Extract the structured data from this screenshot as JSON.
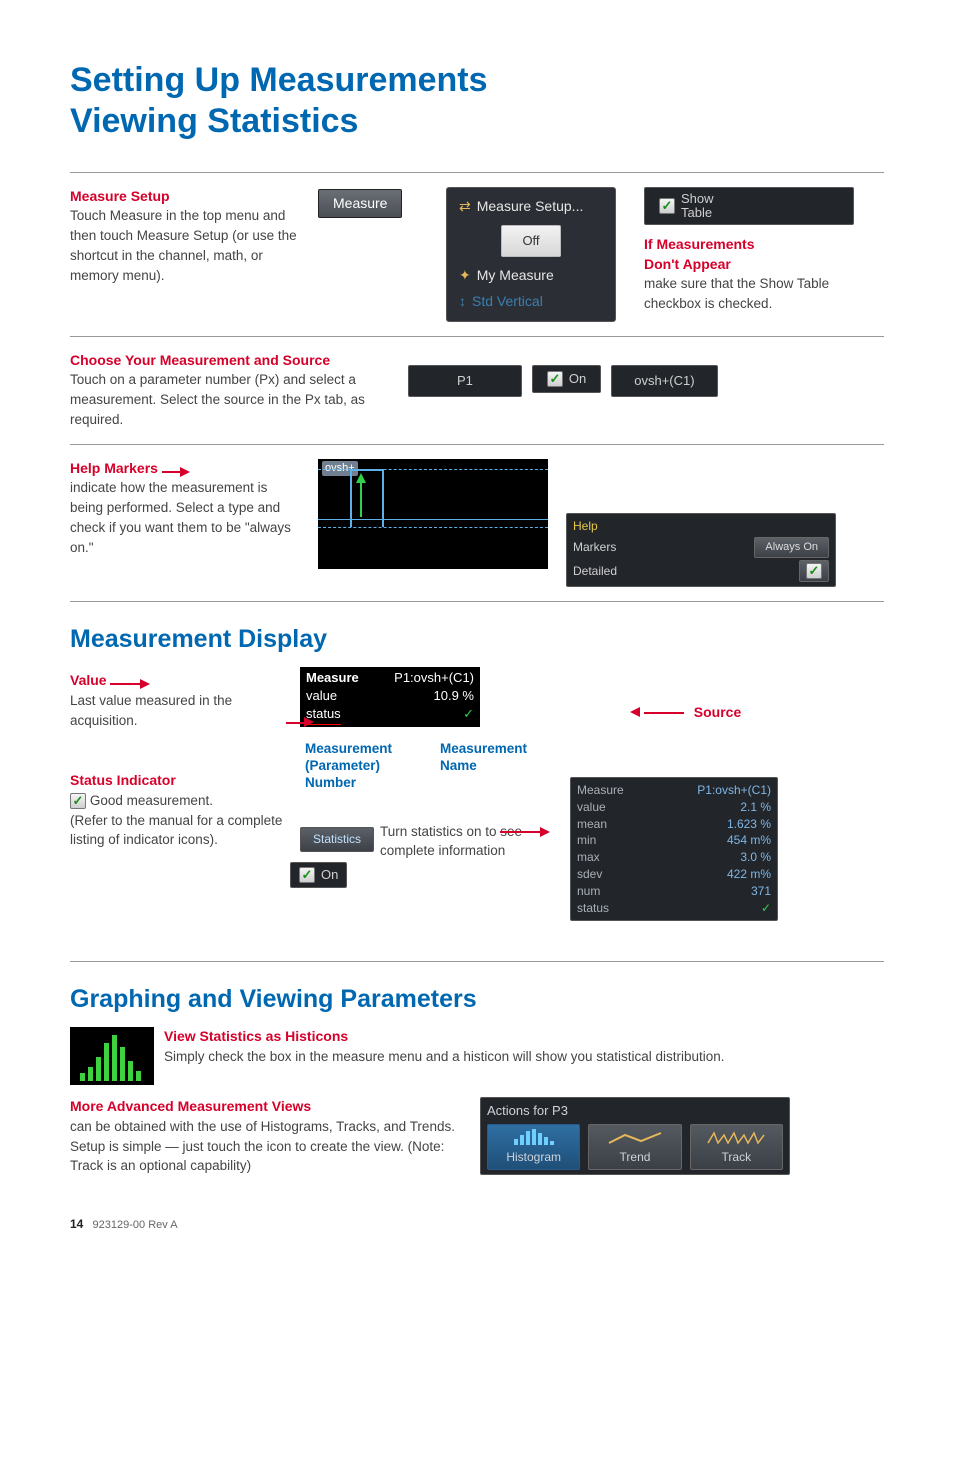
{
  "title_l1": "Setting Up Measurements",
  "title_l2": "Viewing Statistics",
  "s1": {
    "head": "Measure Setup",
    "body": "Touch Measure in the top menu and then touch Measure Setup (or use the shortcut in the channel, math, or memory menu).",
    "btn": "Measure",
    "menu": {
      "setup": "Measure Setup...",
      "off": "Off",
      "my": "My Measure",
      "std": "Std Vertical"
    },
    "show_table": "Show\nTable",
    "warn_head1": "If Measurements",
    "warn_head2": "Don't Appear",
    "warn_body": "make sure that the Show Table checkbox is checked."
  },
  "s2": {
    "head": "Choose Your Measurement and Source",
    "body": "Touch on a parameter number (Px) and select a measurement. Select the source in the Px tab, as required.",
    "p": "P1",
    "on": "On",
    "meas": "ovsh+(C1)"
  },
  "s3": {
    "head": "Help Markers",
    "body": "indicate how the measurement is being performed. Select a type and check if you want them to be \"always on.\"",
    "lbl": "ovsh+",
    "help": "Help",
    "markers": "Markers",
    "always": "Always On",
    "detailed": "Detailed"
  },
  "md_title": "Measurement Display",
  "md": {
    "value_head": "Value",
    "value_body": "Last value measured in the acquisition.",
    "status_head": "Status Indicator",
    "status_good": "Good measurement.",
    "status_body": "(Refer to the manual for a complete listing of indicator icons).",
    "box": {
      "measure": "Measure",
      "p1": "P1:ovsh+(C1)",
      "value": "value",
      "val": "10.9 %",
      "status": "status"
    },
    "lbl_param": "Measurement (Parameter) Number",
    "lbl_name": "Measurement Name",
    "lbl_source": "Source",
    "stats_btn": "Statistics",
    "on": "On",
    "stats_caption": "Turn statistics on to see complete information",
    "table": {
      "Measure": "P1:ovsh+(C1)",
      "value": "2.1 %",
      "mean": "1.623 %",
      "min": "454 m%",
      "max": "3.0 %",
      "sdev": "422 m%",
      "num": "371",
      "status": "✓"
    }
  },
  "gv_title": "Graphing and Viewing Parameters",
  "gv": {
    "hist_head": "View Statistics as Histicons",
    "hist_body": "Simply check the box in the measure menu and a histicon will show you statistical distribution.",
    "adv_head": "More Advanced Measurement Views",
    "adv_body": "can be obtained with the use of Histograms, Tracks, and Trends. Setup is simple — just touch the icon to create the view. (Note: Track is an optional capability)",
    "actions_title": "Actions for P3",
    "buttons": {
      "histogram": "Histogram",
      "trend": "Trend",
      "track": "Track"
    }
  },
  "chart_data": {
    "type": "table",
    "title": "P1:ovsh+(C1) statistics",
    "rows": [
      {
        "label": "value",
        "value": "2.1 %"
      },
      {
        "label": "mean",
        "value": "1.623 %"
      },
      {
        "label": "min",
        "value": "454 m%"
      },
      {
        "label": "max",
        "value": "3.0 %"
      },
      {
        "label": "sdev",
        "value": "422 m%"
      },
      {
        "label": "num",
        "value": 371
      }
    ]
  },
  "footer": {
    "page": "14",
    "rev": "923129-00 Rev A"
  }
}
